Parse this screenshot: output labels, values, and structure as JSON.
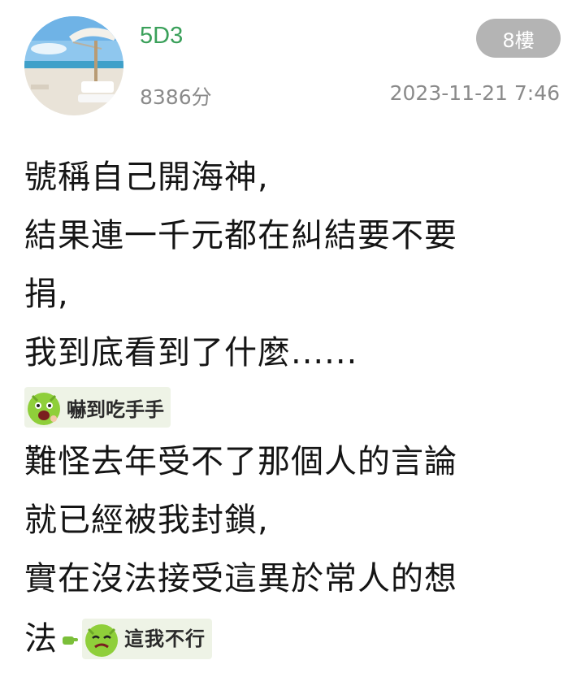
{
  "post": {
    "username": "5D3",
    "points": "8386分",
    "floor": "8樓",
    "time": "2023-11-21 7:46"
  },
  "content": {
    "lines_a": [
      "號稱自己開海神,",
      "結果連一千元都在糾結要不要",
      "捐,",
      "我到底看到了什麼......"
    ],
    "sticker1": {
      "text": "嚇到吃手手",
      "icon": "shocked-face-icon"
    },
    "lines_b": [
      "難怪去年受不了那個人的言論",
      "就已經被我封鎖,",
      "實在沒法接受這異於常人的想"
    ],
    "last_line": "法",
    "sticker2": {
      "text": "這我不行",
      "icon": "disgusted-face-icon"
    },
    "finger_icon": "pointing-finger-icon"
  },
  "colors": {
    "username": "#3aa05a",
    "badge_bg": "#b4b4b4",
    "meta": "#8a8a8a",
    "sticker_bg": "#eef3e6"
  }
}
